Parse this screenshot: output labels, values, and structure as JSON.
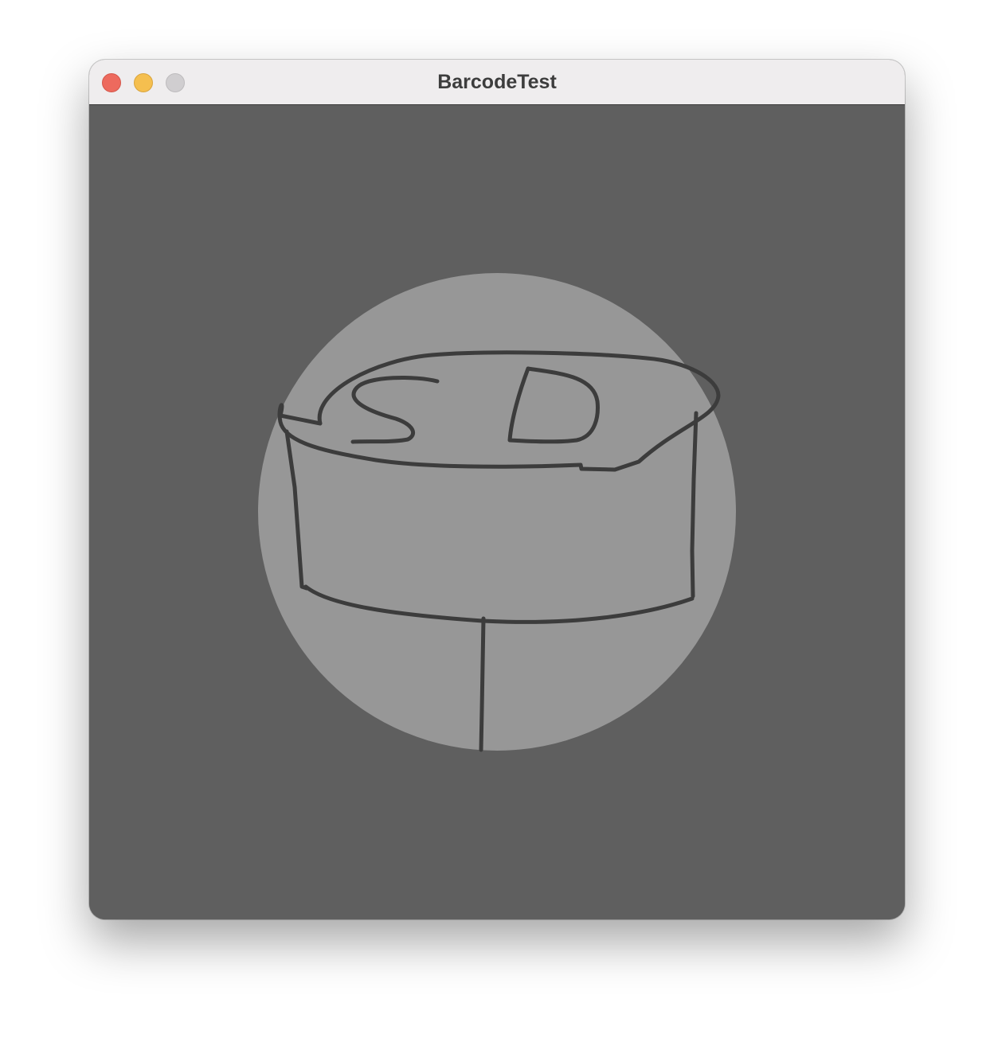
{
  "window": {
    "title": "BarcodeTest"
  },
  "drawing": {
    "letters": [
      "S",
      "D"
    ],
    "icon": "sd-card-drawing-icon"
  },
  "colors": {
    "titlebar": "#efedee",
    "canvas": "#5f5f5f",
    "circle": "#979797",
    "stroke": "#3c3c3c",
    "close": "#ed6a5e",
    "minimize": "#f5bf4f",
    "zoom": "#d0ced0"
  }
}
